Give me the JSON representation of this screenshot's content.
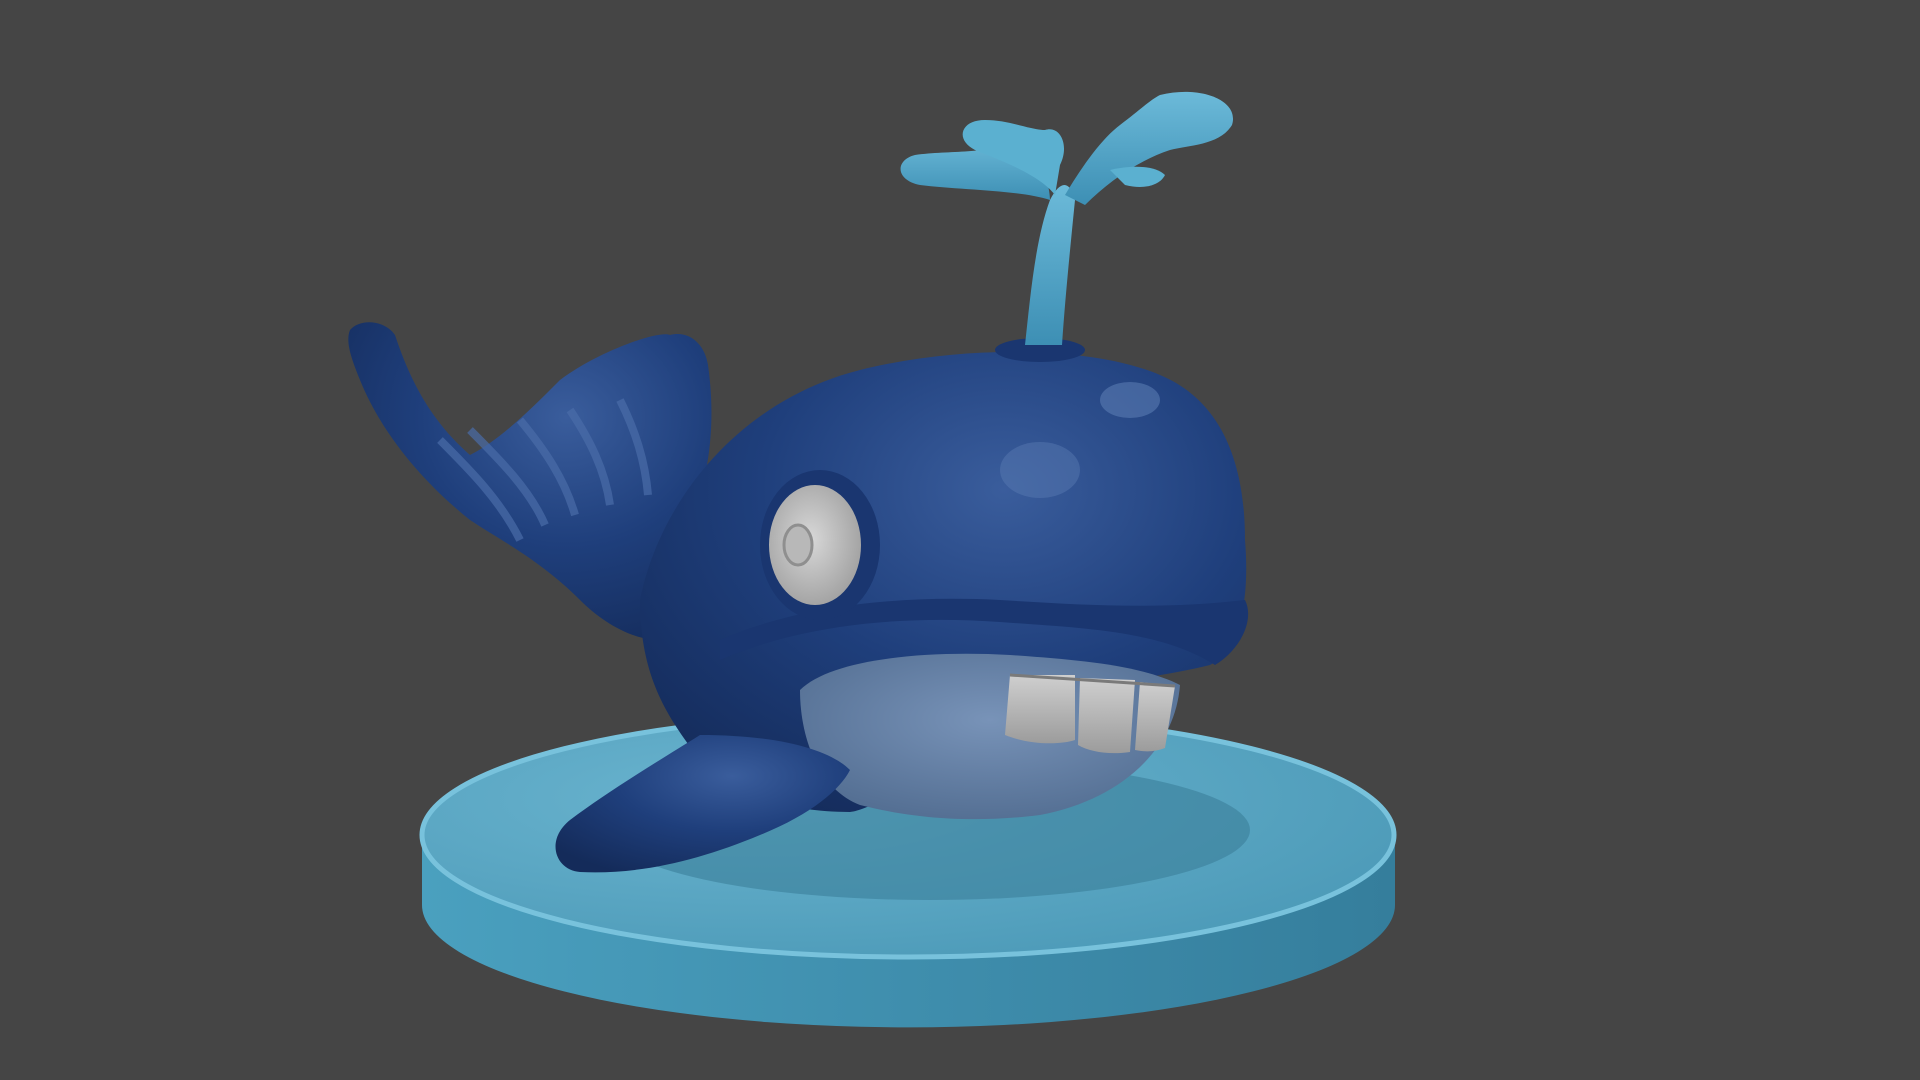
{
  "scene": {
    "subject": "whale-figurine",
    "colors": {
      "background": "#454545",
      "whale_body": "#1f3f7c",
      "whale_shadow": "#132a57",
      "whale_highlight": "#5a7ab0",
      "belly": "#6a86ab",
      "belly_shadow": "#4f6a8e",
      "spout": "#4aa3c7",
      "spout_highlight": "#7cc6e2",
      "base_top": "#4f9fbd",
      "base_side": "#3d8aa8",
      "base_rim": "#63b3cf",
      "teeth": "#bdbdbd",
      "teeth_shadow": "#8f8f8f",
      "eye": "#c8c8c8",
      "eye_shadow": "#9a9a9a"
    }
  }
}
